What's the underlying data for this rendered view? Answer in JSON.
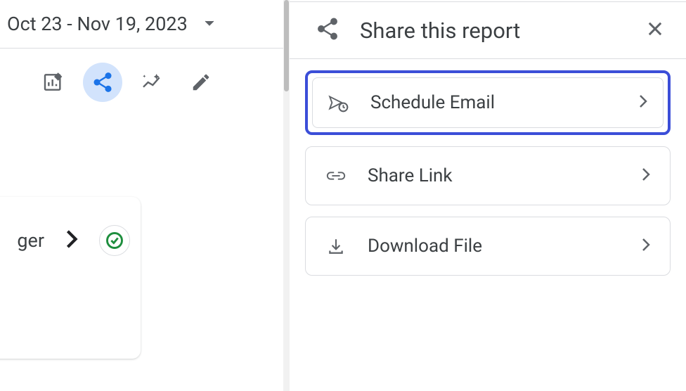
{
  "dateRange": "Oct 23 - Nov 19, 2023",
  "leftCard": {
    "textFragment": "ger"
  },
  "sharePanel": {
    "title": "Share this report",
    "options": [
      {
        "label": "Schedule Email"
      },
      {
        "label": "Share Link"
      },
      {
        "label": "Download File"
      }
    ]
  }
}
